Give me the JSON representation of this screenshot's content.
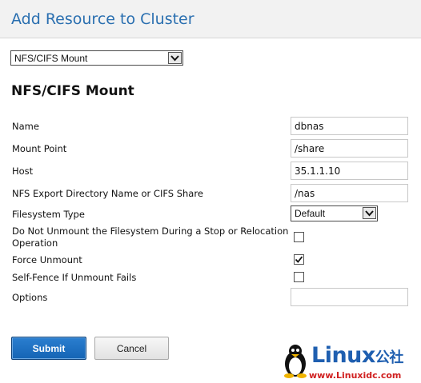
{
  "dialog": {
    "title": "Add Resource to Cluster"
  },
  "resource_type": {
    "selected": "NFS/CIFS Mount"
  },
  "section": {
    "title": "NFS/CIFS Mount"
  },
  "fields": {
    "name": {
      "label": "Name",
      "value": "dbnas"
    },
    "mount_point": {
      "label": "Mount Point",
      "value": "/share"
    },
    "host": {
      "label": "Host",
      "value": "35.1.1.10"
    },
    "export": {
      "label": "NFS Export Directory Name or CIFS Share",
      "value": "/nas"
    },
    "fs_type": {
      "label": "Filesystem Type",
      "selected": "Default"
    },
    "no_unmount": {
      "label_line1": "Do Not Unmount the Filesystem During a Stop or Relocation",
      "label_line2": "Operation",
      "checked": false
    },
    "force_unmount": {
      "label": "Force Unmount",
      "checked": true
    },
    "self_fence": {
      "label": "Self-Fence If Unmount Fails",
      "checked": false
    },
    "options": {
      "label": "Options",
      "value": ""
    }
  },
  "buttons": {
    "submit": "Submit",
    "cancel": "Cancel"
  },
  "watermark": {
    "brand": "Linux",
    "suffix": "公社",
    "url": "www.Linuxidc.com"
  }
}
